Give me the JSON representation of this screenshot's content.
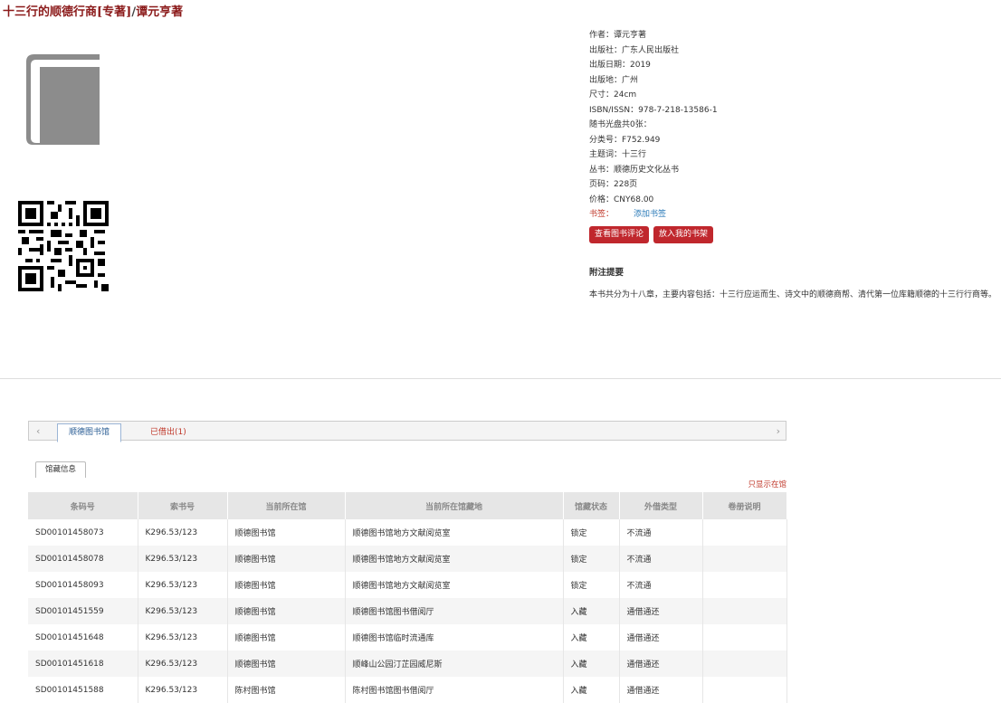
{
  "book": {
    "title": "十三行的顺德行商[专著]",
    "slash": "/",
    "author": "谭元亨著"
  },
  "icons": {
    "cover": "book-icon",
    "qr": "qr-code-icon"
  },
  "meta": [
    "作者：谭元亨著",
    "出版社：广东人民出版社",
    "出版日期：2019",
    "出版地：广州",
    "尺寸：24cm",
    "ISBN/ISSN：978-7-218-13586-1",
    "随书光盘共0张：",
    "分类号：F752.949",
    "主题词：十三行",
    "丛书：顺德历史文化丛书",
    "页码：228页",
    "价格：CNY68.00"
  ],
  "tags": {
    "label": "书签：",
    "add_link": "添加书签"
  },
  "buttons": {
    "view_reviews": "查看图书评论",
    "add_shelf": "放入我的书架"
  },
  "abstract": {
    "heading": "附注提要",
    "text": "本书共分为十八章，主要内容包括：十三行应运而生、诗文中的顺德商帮、清代第一位库籍顺德的十三行行商等。"
  },
  "holdings": {
    "tabs": [
      "顺德图书馆",
      "已借出(1)"
    ],
    "subtab": "馆藏信息",
    "only_in": "只显示在馆",
    "columns": [
      "条码号",
      "索书号",
      "当前所在馆",
      "当前所在馆藏地",
      "馆藏状态",
      "外借类型",
      "卷册说明"
    ],
    "rows": [
      [
        "SD00101458073",
        "K296.53/123",
        "顺德图书馆",
        "顺德图书馆地方文献阅览室",
        "锁定",
        "不流通",
        ""
      ],
      [
        "SD00101458078",
        "K296.53/123",
        "顺德图书馆",
        "顺德图书馆地方文献阅览室",
        "锁定",
        "不流通",
        ""
      ],
      [
        "SD00101458093",
        "K296.53/123",
        "顺德图书馆",
        "顺德图书馆地方文献阅览室",
        "锁定",
        "不流通",
        ""
      ],
      [
        "SD00101451559",
        "K296.53/123",
        "顺德图书馆",
        "顺德图书馆图书借阅厅",
        "入藏",
        "通借通还",
        ""
      ],
      [
        "SD00101451648",
        "K296.53/123",
        "顺德图书馆",
        "顺德图书馆临时流通库",
        "入藏",
        "通借通还",
        ""
      ],
      [
        "SD00101451618",
        "K296.53/123",
        "顺德图书馆",
        "顺峰山公园汀芷园威尼斯",
        "入藏",
        "通借通还",
        ""
      ],
      [
        "SD00101451588",
        "K296.53/123",
        "陈村图书馆",
        "陈村图书馆图书借阅厅",
        "入藏",
        "通借通还",
        ""
      ]
    ]
  }
}
